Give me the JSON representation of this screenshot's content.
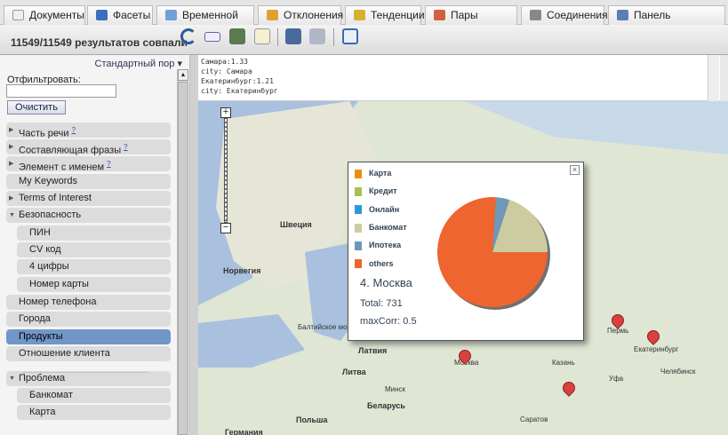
{
  "tabs": [
    "Документы",
    "Фасеты",
    "Временной ряд",
    "Отклонения",
    "Тенденции",
    "Пары фасетов",
    "Соединения",
    "Панель управления"
  ],
  "toolbar": {
    "count": "11549/11549 результатов совпали"
  },
  "sidebar": {
    "sort": "Стандартный пор",
    "filter_label": "Отфильтровать:",
    "filter_value": "",
    "clear": "Очистить",
    "items": [
      {
        "label": "Часть речи",
        "help": "?",
        "arrow": "▶"
      },
      {
        "label": "Составляющая фразы",
        "help": "?",
        "arrow": "▶"
      },
      {
        "label": "Элемент с именем",
        "help": "?",
        "arrow": "▶"
      },
      {
        "label": "My Keywords"
      },
      {
        "label": "Terms of Interest",
        "arrow": "▶"
      },
      {
        "label": "Безопасность",
        "arrow": "▼"
      },
      {
        "label": "ПИН"
      },
      {
        "label": "CV код"
      },
      {
        "label": "4 цифры"
      },
      {
        "label": "Номер карты"
      },
      {
        "label": "Номер телефона"
      },
      {
        "label": "Города"
      },
      {
        "label": "Продукты"
      },
      {
        "label": "Отношение клиента"
      },
      {
        "label": "Проблема",
        "arrow": "▼"
      },
      {
        "label": "Банкомат"
      },
      {
        "label": "Карта"
      }
    ]
  },
  "info_lines": [
    "Самара:1.33",
    "city: Самара",
    "Екатеринбург:1.21",
    "city: Екатеринбург"
  ],
  "map": {
    "labels": [
      "Швеция",
      "Норвегия",
      "Литва",
      "Латвия",
      "Беларусь",
      "Польша",
      "Германия",
      "Москва",
      "Пермь",
      "Екатеринбург",
      "Челябинск",
      "Уфа",
      "Казань",
      "Саратов",
      "Минск",
      "Балтийское море"
    ]
  },
  "popup": {
    "title": "4. Москва",
    "total": "Total: 731",
    "maxcorr": "maxCorr: 0.5",
    "close": "×",
    "legend": [
      {
        "label": "Карта",
        "color": "#e8900c"
      },
      {
        "label": "Кредит",
        "color": "#a8c050"
      },
      {
        "label": "Онлайн",
        "color": "#2a9ad8"
      },
      {
        "label": "Банкомат",
        "color": "#cccca0"
      },
      {
        "label": "Ипотека",
        "color": "#6f98b8"
      },
      {
        "label": "others",
        "color": "#ee6530"
      }
    ]
  },
  "chart_data": {
    "type": "pie",
    "title": "4. Москва",
    "categories": [
      "Карта",
      "Кредит",
      "Онлайн",
      "Банкомат",
      "Ипотека",
      "others"
    ],
    "values": [
      0,
      0,
      0,
      20,
      4,
      76
    ]
  }
}
